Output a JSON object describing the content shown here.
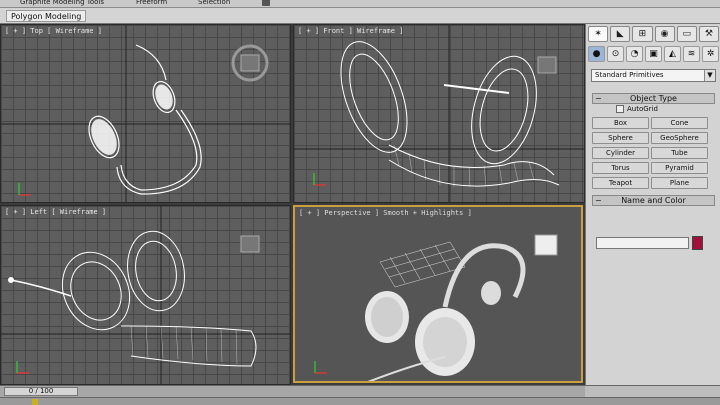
{
  "ribbon": {
    "tabs": [
      {
        "label": "Graphite Modeling Tools"
      },
      {
        "label": "Freeform"
      },
      {
        "label": "Selection"
      }
    ],
    "panel_label": "Polygon Modeling"
  },
  "viewports": {
    "top": {
      "label": "[ + ] Top [ Wireframe ]"
    },
    "front": {
      "label": "[ + ] Front ] Wireframe ]"
    },
    "left": {
      "label": "[ + ] Left [ Wireframe ]"
    },
    "perspective": {
      "label": "[ + ] Perspective ] Smooth + Highlights ]"
    }
  },
  "command_panel": {
    "tab_icons": [
      "create-tab-icon",
      "modify-tab-icon",
      "hierarchy-tab-icon",
      "motion-tab-icon",
      "display-tab-icon",
      "utilities-tab-icon"
    ],
    "category_icons": [
      "geometry-icon",
      "shapes-icon",
      "lights-icon",
      "cameras-icon",
      "helpers-icon",
      "spacewarps-icon",
      "systems-icon"
    ],
    "primitive_dropdown": "Standard Primitives",
    "object_type_title": "Object Type",
    "autogrid_label": "AutoGrid",
    "object_buttons": [
      "Box",
      "Cone",
      "Sphere",
      "GeoSphere",
      "Cylinder",
      "Tube",
      "Torus",
      "Pyramid",
      "Teapot",
      "Plane"
    ],
    "name_color_title": "Name and Color",
    "name_value": "",
    "color": "#a0103a"
  },
  "timeline": {
    "frame_display": "0 / 100"
  },
  "colors": {
    "wire": "#ffffff",
    "active_border": "#c8a040",
    "viewport_bg": "#5e5e5e"
  }
}
